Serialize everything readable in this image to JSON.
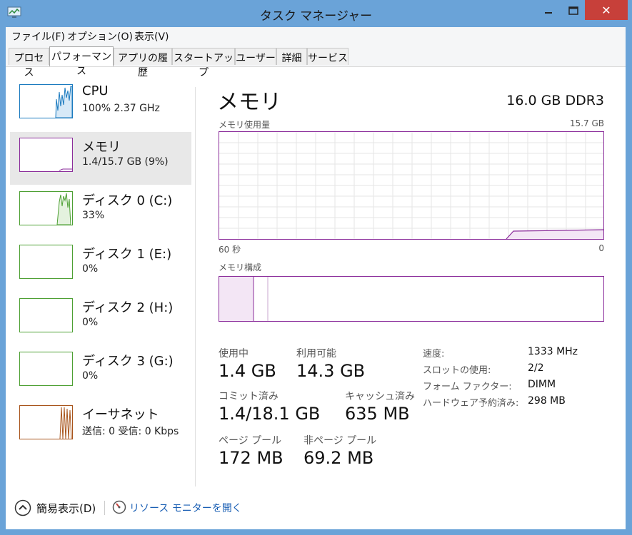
{
  "window": {
    "title": "タスク マネージャー",
    "close_glyph": "✕"
  },
  "menu": [
    "ファイル(F)",
    "オプション(O)",
    "表示(V)"
  ],
  "tabs": [
    {
      "label": "プロセス",
      "active": false
    },
    {
      "label": "パフォーマンス",
      "active": true
    },
    {
      "label": "アプリの履歴",
      "active": false
    },
    {
      "label": "スタートアップ",
      "active": false
    },
    {
      "label": "ユーザー",
      "active": false
    },
    {
      "label": "詳細",
      "active": false
    },
    {
      "label": "サービス",
      "active": false
    }
  ],
  "sidebar": [
    {
      "name": "CPU",
      "sub": "100% 2.37 GHz",
      "color": "#1a7abf"
    },
    {
      "name": "メモリ",
      "sub": "1.4/15.7 GB (9%)",
      "color": "#8b2d9b"
    },
    {
      "name": "ディスク 0 (C:)",
      "sub": "33%",
      "color": "#4da033"
    },
    {
      "name": "ディスク 1 (E:)",
      "sub": "0%",
      "color": "#4da033"
    },
    {
      "name": "ディスク 2 (H:)",
      "sub": "0%",
      "color": "#4da033"
    },
    {
      "name": "ディスク 3 (G:)",
      "sub": "0%",
      "color": "#4da033"
    },
    {
      "name": "イーサネット",
      "sub": "送信: 0 受信: 0 Kbps",
      "color": "#a8541b"
    }
  ],
  "main": {
    "title": "メモリ",
    "spec": "16.0 GB DDR3",
    "usage_label": "メモリ使用量",
    "usage_max": "15.7 GB",
    "axis_left": "60 秒",
    "axis_right": "0",
    "composition_label": "メモリ構成",
    "accent_color": "#8b2d9b"
  },
  "stats": {
    "in_use_label": "使用中",
    "in_use_value": "1.4 GB",
    "available_label": "利用可能",
    "available_value": "14.3 GB",
    "committed_label": "コミット済み",
    "committed_value": "1.4/18.1 GB",
    "cached_label": "キャッシュ済み",
    "cached_value": "635 MB",
    "paged_label": "ページ プール",
    "paged_value": "172 MB",
    "nonpaged_label": "非ページ プール",
    "nonpaged_value": "69.2 MB"
  },
  "details": [
    {
      "label": "速度:",
      "value": "1333 MHz"
    },
    {
      "label": "スロットの使用:",
      "value": "2/2"
    },
    {
      "label": "フォーム ファクター:",
      "value": "DIMM"
    },
    {
      "label": "ハードウェア予約済み:",
      "value": "298 MB"
    }
  ],
  "footer": {
    "fewer_details": "簡易表示(D)",
    "resource_monitor": "リソース モニターを開く"
  }
}
